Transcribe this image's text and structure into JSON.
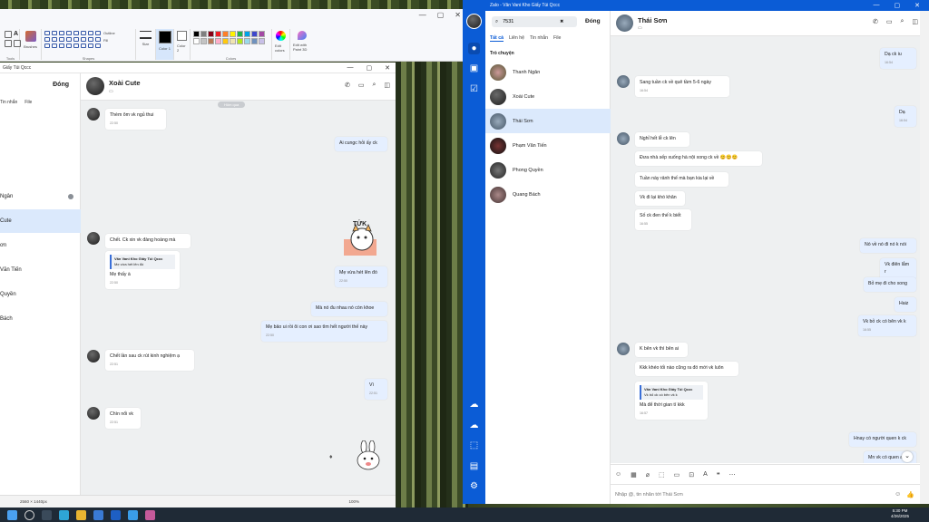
{
  "paint": {
    "groups": {
      "tools": "Tools",
      "shapes": "Shapes",
      "colors": "Colors"
    },
    "brushes_label": "Brushes",
    "outline_label": "Outline",
    "fill_label": "Fill",
    "size_label": "Size",
    "color1_label": "Color 1",
    "color2_label": "Color 2",
    "edit_colors_label": "Edit colors",
    "edit_paint3d_label": "Edit with Paint 3D",
    "status_dims": "2560 × 1440px",
    "zoom": "100%",
    "palette": [
      "#000000",
      "#7f7f7f",
      "#880015",
      "#ed1c24",
      "#ff7f27",
      "#fff200",
      "#22b14c",
      "#00a2e8",
      "#3f48cc",
      "#a349a4",
      "#ffffff",
      "#c3c3c3",
      "#b97a57",
      "#ffaec9",
      "#ffc90e",
      "#efe4b0",
      "#b5e61d",
      "#99d9ea",
      "#7092be",
      "#c8bfe7"
    ]
  },
  "left": {
    "title": "Giấy Túi Qccc",
    "close_label": "Đóng",
    "tabs": [
      "Tin nhắn",
      "File"
    ],
    "contacts": [
      "Ngân",
      "Cute",
      "ơn",
      "Văn Tiến",
      "Quyền",
      "Bách"
    ],
    "chat_name": "Xoài Cute",
    "date_chip": "Hôm qua",
    "messages": [
      {
        "text": "Thèm ôm vk ngủ thui",
        "time": "22:50"
      },
      {
        "text": "Ai cungc hỏi ấy ck",
        "time": ""
      },
      {
        "text": "Mẹ vừa hét lên đó",
        "time": "22:50"
      },
      {
        "text": "Chết. Ck xin vk đàng hoàng mà",
        "time": ""
      },
      {
        "quote_name": "Văn Vani Kho Giấy Túi Qccc",
        "quote_text": "Mẹ vừa hét lên đó",
        "text": "Mẹ thấy à",
        "time": "22:50"
      },
      {
        "text": "Mà nó đu nhau nó còn khoe",
        "time": ""
      },
      {
        "text": "Mẹ bảo ui rồi ôi con ơi sao tìm hết người thế này",
        "time": "22:50"
      },
      {
        "text": "Chết lần sau ck rút kinh nghiệm ạ",
        "time": "22:51"
      },
      {
        "text": "Vì",
        "time": "22:51"
      },
      {
        "text": "Chìn nổi vk",
        "time": "22:51"
      }
    ],
    "sticker_text": "TỨK"
  },
  "right": {
    "window_title": "Zalo - Văn Vani Kho Giấy Túi Qccc",
    "search_value": "7531",
    "close_label": "Đóng",
    "tabs": [
      "Tất cả",
      "Liên hệ",
      "Tin nhắn",
      "File"
    ],
    "section": "Trò chuyện",
    "contacts": [
      "Thanh Ngân",
      "Xoài Cute",
      "Thái Sơn",
      "Phạm Văn Tiến",
      "Phong Quyền",
      "Quang Bách"
    ],
    "chat_name": "Thái Sơn",
    "messages": [
      {
        "text": "Dạ ck iu",
        "time": "16:54"
      },
      {
        "text": "Sang tuần ck về quê tầm 5-6 ngày",
        "time": "16:54"
      },
      {
        "text": "Dạ",
        "time": "16:54"
      },
      {
        "text": "Nghỉ hết lễ ck lên",
        "time": ""
      },
      {
        "text": "Đưa nhà sếp xuống hà nội xong ck về 😊😊😊",
        "time": ""
      },
      {
        "text": "Tuần này rảnh thế mà bạn kia lại về",
        "time": ""
      },
      {
        "text": "Vk đi lại khó khăn",
        "time": ""
      },
      {
        "text": "Số ck đen thế k biết",
        "time": "16:55"
      },
      {
        "text": "Nó về nó đi nó k nói",
        "time": ""
      },
      {
        "text": "Vk điên lắm r",
        "time": ""
      },
      {
        "text": "Bỏ mẹ đi cho xong",
        "time": ""
      },
      {
        "text": "Haiz",
        "time": ""
      },
      {
        "text": "Vk bỏ ck có bên vk k",
        "time": "16:55"
      },
      {
        "text": "K bên vk thì bên ai",
        "time": ""
      },
      {
        "text": "Kkk khéo tối nào cũng ra đó mới vk luôn",
        "time": ""
      },
      {
        "quote_name": "Văn Vani Kho Giấy Túi Qccc",
        "quote_text": "Vk bỏ ck có bên vk k",
        "text": "Mà để thời gian tí kkk",
        "time": "16:57"
      },
      {
        "text": "Hnay có người quen k ck",
        "time": ""
      },
      {
        "text": "Mn vk có quen a",
        "time": ""
      }
    ],
    "composer_placeholder": "Nhập @, tin nhắn tới Thái Sơn"
  },
  "taskbar": {
    "time": "5:30 PM",
    "date": "4/26/2025"
  }
}
